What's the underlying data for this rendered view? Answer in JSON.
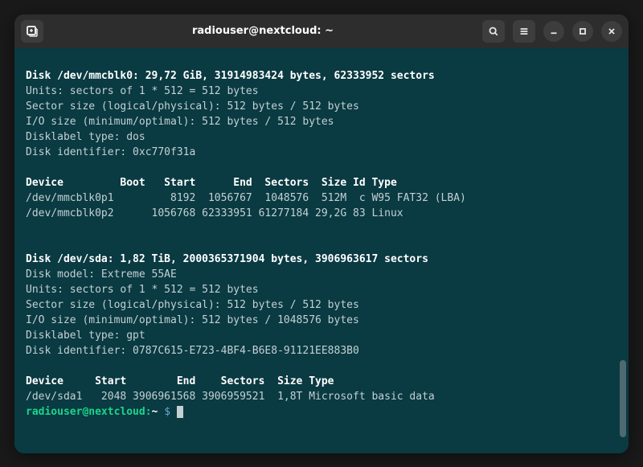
{
  "titlebar": {
    "title": "radiouser@nextcloud: ~"
  },
  "disk0": {
    "header": "Disk /dev/mmcblk0: 29,72 GiB, 31914983424 bytes, 62333952 sectors",
    "units": "Units: sectors of 1 * 512 = 512 bytes",
    "sector_size": "Sector size (logical/physical): 512 bytes / 512 bytes",
    "io_size": "I/O size (minimum/optimal): 512 bytes / 512 bytes",
    "disklabel": "Disklabel type: dos",
    "disk_id": "Disk identifier: 0xc770f31a",
    "table_header": "Device         Boot   Start      End  Sectors  Size Id Type",
    "rows": [
      "/dev/mmcblk0p1         8192  1056767  1048576  512M  c W95 FAT32 (LBA)",
      "/dev/mmcblk0p2      1056768 62333951 61277184 29,2G 83 Linux"
    ]
  },
  "disk1": {
    "header": "Disk /dev/sda: 1,82 TiB, 2000365371904 bytes, 3906963617 sectors",
    "model": "Disk model: Extreme 55AE    ",
    "units": "Units: sectors of 1 * 512 = 512 bytes",
    "sector_size": "Sector size (logical/physical): 512 bytes / 512 bytes",
    "io_size": "I/O size (minimum/optimal): 512 bytes / 1048576 bytes",
    "disklabel": "Disklabel type: gpt",
    "disk_id": "Disk identifier: 0787C615-E723-4BF4-B6E8-91121EE883B0",
    "table_header": "Device     Start        End    Sectors  Size Type",
    "rows": [
      "/dev/sda1   2048 3906961568 3906959521  1,8T Microsoft basic data"
    ]
  },
  "prompt": {
    "user_host": "radiouser@nextcloud",
    "colon": ":",
    "path": "~",
    "dollar": " $ "
  }
}
